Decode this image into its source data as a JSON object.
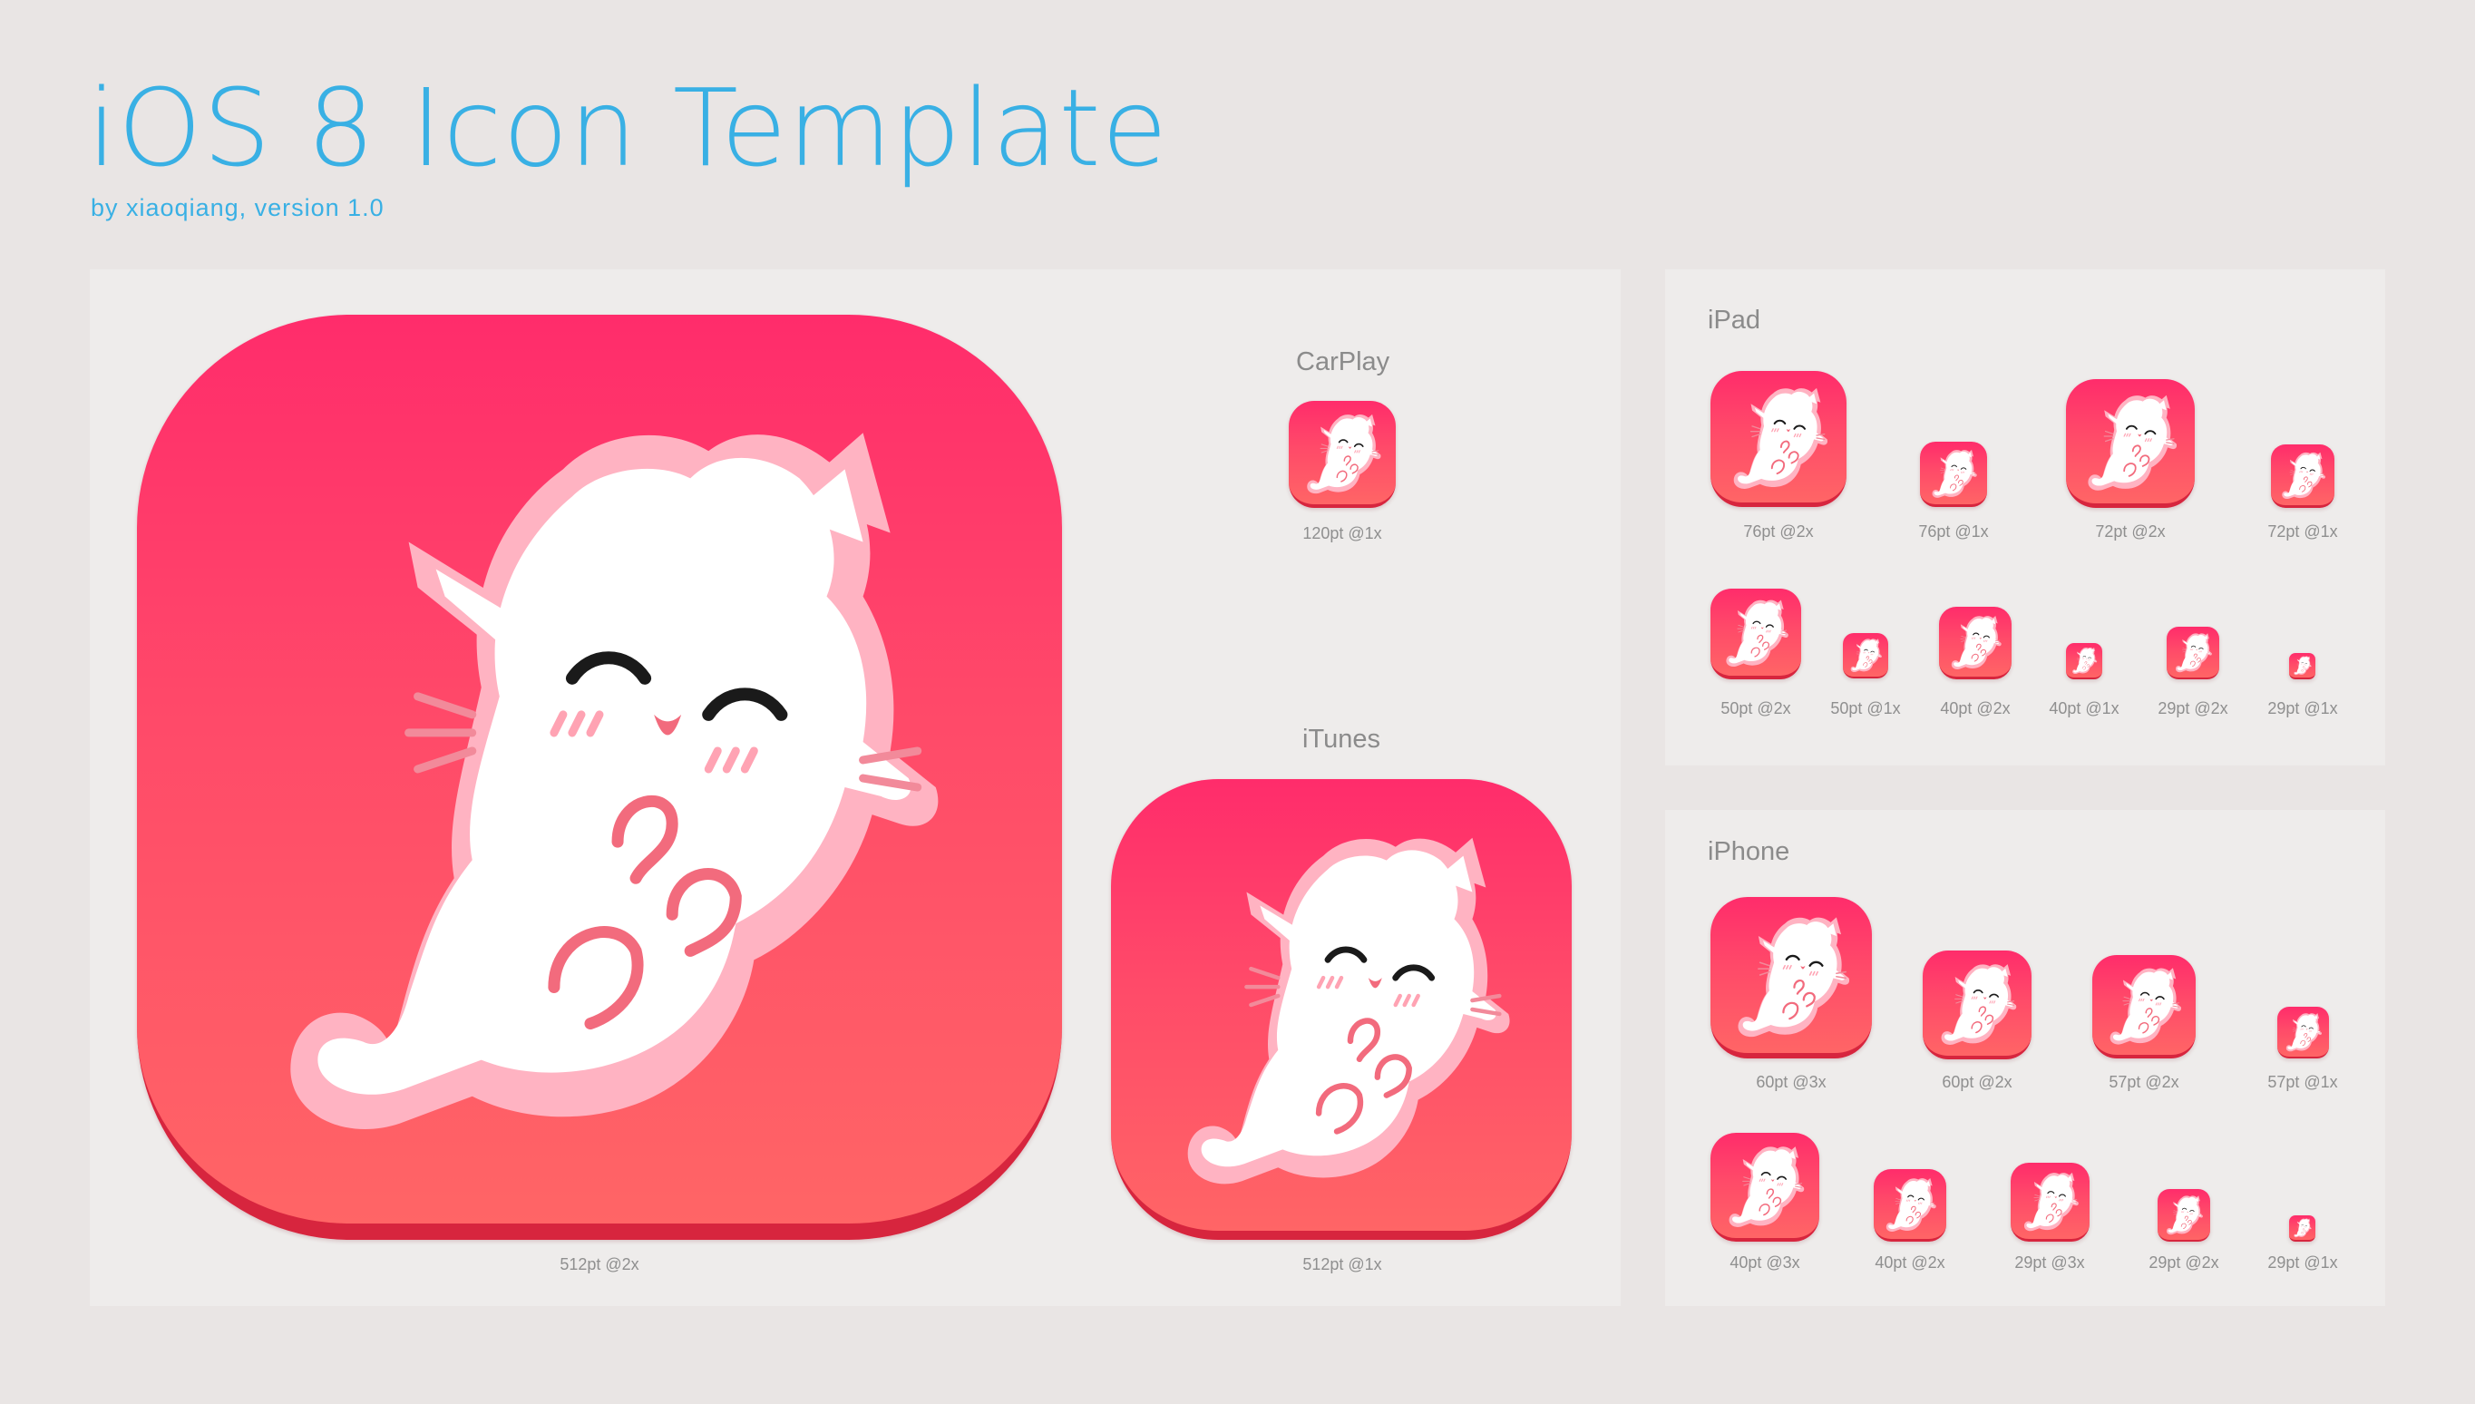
{
  "header": {
    "title": "iOS 8 Icon Template",
    "subtitle": "by xiaoqiang, version 1.0"
  },
  "main_panel": {
    "large_icon_caption": "512pt @2x",
    "carplay": {
      "heading": "CarPlay",
      "caption": "120pt @1x"
    },
    "itunes": {
      "heading": "iTunes",
      "caption": "512pt @1x"
    }
  },
  "ipad": {
    "heading": "iPad",
    "captions": [
      "76pt @2x",
      "76pt @1x",
      "72pt @2x",
      "72pt @1x",
      "50pt @2x",
      "50pt @1x",
      "40pt @2x",
      "40pt @1x",
      "29pt @2x",
      "29pt @1x"
    ]
  },
  "iphone": {
    "heading": "iPhone",
    "captions": [
      "60pt @3x",
      "60pt @2x",
      "57pt @2x",
      "57pt @1x",
      "40pt @3x",
      "40pt @2x",
      "29pt @3x",
      "29pt @2x",
      "29pt @1x"
    ]
  },
  "colors": {
    "title": "#39b0e4",
    "icon_top": "#ff2c6b",
    "icon_bottom": "#ff6566",
    "icon_edge": "#d7253e",
    "cat_outline": "#ffb3c2",
    "cat_body": "#ffffff",
    "cat_accent": "#f26b7d"
  },
  "icon_motif": "cat-icon"
}
